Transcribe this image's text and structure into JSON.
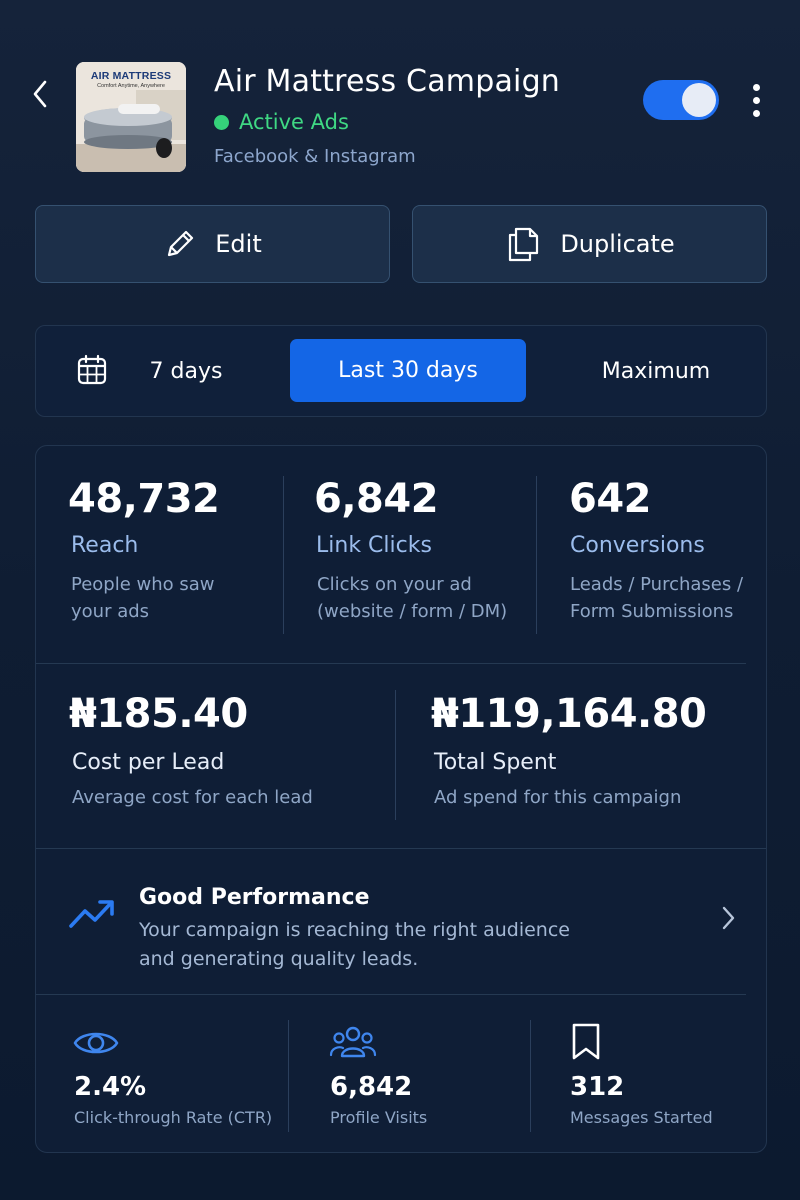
{
  "header": {
    "title": "Air Mattress Campaign",
    "status": "Active Ads",
    "platform": "Facebook & Instagram",
    "thumbnail": {
      "title": "AIR MATTRESS",
      "subtitle": "Comfort Anytime, Anywhere"
    },
    "toggle_on": true,
    "colors": {
      "status": "#35d27a",
      "toggle": "#1f6ef0"
    }
  },
  "actions": {
    "edit_label": "Edit",
    "duplicate_label": "Duplicate"
  },
  "date_range": {
    "tabs": [
      "7 days",
      "Last 30 days",
      "Maximum"
    ],
    "selected": "Last 30 days",
    "accent": "#1466e6"
  },
  "stats": {
    "reach": {
      "value": "48,732",
      "label": "Reach",
      "desc_1": "People who saw",
      "desc_2": "your ads"
    },
    "clicks": {
      "value": "6,842",
      "label": "Link Clicks",
      "desc_1": "Clicks on your ad",
      "desc_2": "(website / form / DM)"
    },
    "conversions": {
      "value": "642",
      "label": "Conversions",
      "desc_1": "Leads / Purchases /",
      "desc_2": "Form Submissions"
    },
    "cpl": {
      "value": "₦185.40",
      "label": "Cost per Lead",
      "desc": "Average cost for each lead"
    },
    "spent": {
      "value": "₦119,164.80",
      "label": "Total Spent",
      "desc": "Ad spend for this campaign"
    }
  },
  "performance": {
    "title": "Good Performance",
    "desc_1": "Your campaign is reaching the right audience",
    "desc_2": "and generating quality leads."
  },
  "mini_stats": {
    "ctr": {
      "value": "2.4%",
      "label": "Click-through Rate (CTR)",
      "icon": "eye-icon"
    },
    "visits": {
      "value": "6,842",
      "label": "Profile Visits",
      "icon": "users-icon"
    },
    "messages": {
      "value": "312",
      "label": "Messages Started",
      "icon": "bookmark-icon"
    }
  }
}
